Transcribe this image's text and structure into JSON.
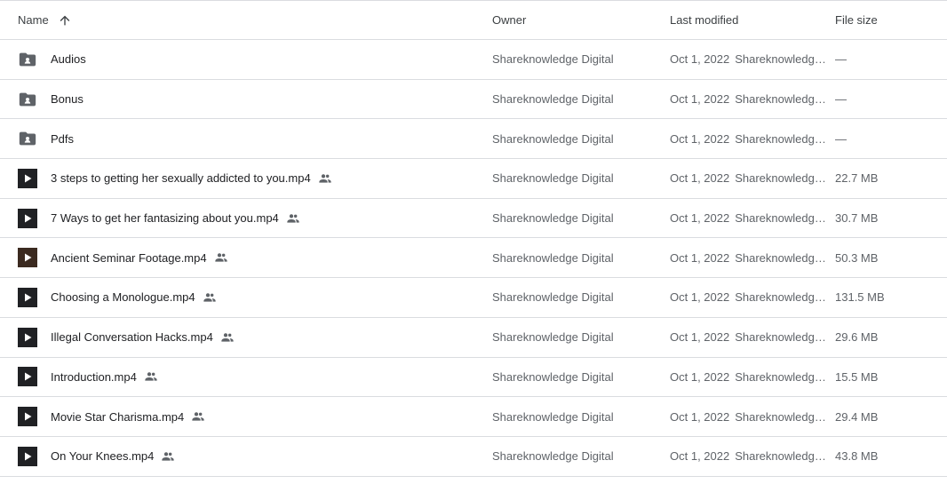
{
  "header": {
    "name_label": "Name",
    "owner_label": "Owner",
    "modified_label": "Last modified",
    "size_label": "File size",
    "sort_icon": "arrow-up-icon"
  },
  "rows": [
    {
      "type": "folder",
      "name": "Audios",
      "shared": false,
      "owner": "Shareknowledge Digital",
      "date": "Oct 1, 2022",
      "modified_by": "Shareknowledge Digital",
      "size": "—"
    },
    {
      "type": "folder",
      "name": "Bonus",
      "shared": false,
      "owner": "Shareknowledge Digital",
      "date": "Oct 1, 2022",
      "modified_by": "Shareknowledge Digital",
      "size": "—"
    },
    {
      "type": "folder",
      "name": "Pdfs",
      "shared": false,
      "owner": "Shareknowledge Digital",
      "date": "Oct 1, 2022",
      "modified_by": "Shareknowledge Digital",
      "size": "—"
    },
    {
      "type": "video",
      "name": "3 steps to getting her sexually addicted to you.mp4",
      "shared": true,
      "owner": "Shareknowledge Digital",
      "date": "Oct 1, 2022",
      "modified_by": "Shareknowledge Digital",
      "size": "22.7 MB"
    },
    {
      "type": "video",
      "name": "7 Ways to get her fantasizing about you.mp4",
      "shared": true,
      "owner": "Shareknowledge Digital",
      "date": "Oct 1, 2022",
      "modified_by": "Shareknowledge Digital",
      "size": "30.7 MB"
    },
    {
      "type": "video-thumb",
      "name": "Ancient Seminar Footage.mp4",
      "shared": true,
      "owner": "Shareknowledge Digital",
      "date": "Oct 1, 2022",
      "modified_by": "Shareknowledge Digital",
      "size": "50.3 MB"
    },
    {
      "type": "video",
      "name": "Choosing a Monologue.mp4",
      "shared": true,
      "owner": "Shareknowledge Digital",
      "date": "Oct 1, 2022",
      "modified_by": "Shareknowledge Digital",
      "size": "131.5 MB"
    },
    {
      "type": "video",
      "name": "Illegal Conversation Hacks.mp4",
      "shared": true,
      "owner": "Shareknowledge Digital",
      "date": "Oct 1, 2022",
      "modified_by": "Shareknowledge Digital",
      "size": "29.6 MB"
    },
    {
      "type": "video",
      "name": "Introduction.mp4",
      "shared": true,
      "owner": "Shareknowledge Digital",
      "date": "Oct 1, 2022",
      "modified_by": "Shareknowledge Digital",
      "size": "15.5 MB"
    },
    {
      "type": "video",
      "name": "Movie Star Charisma.mp4",
      "shared": true,
      "owner": "Shareknowledge Digital",
      "date": "Oct 1, 2022",
      "modified_by": "Shareknowledge Digital",
      "size": "29.4 MB"
    },
    {
      "type": "video",
      "name": "On Your Knees.mp4",
      "shared": true,
      "owner": "Shareknowledge Digital",
      "date": "Oct 1, 2022",
      "modified_by": "Shareknowledge Digital",
      "size": "43.8 MB"
    }
  ]
}
